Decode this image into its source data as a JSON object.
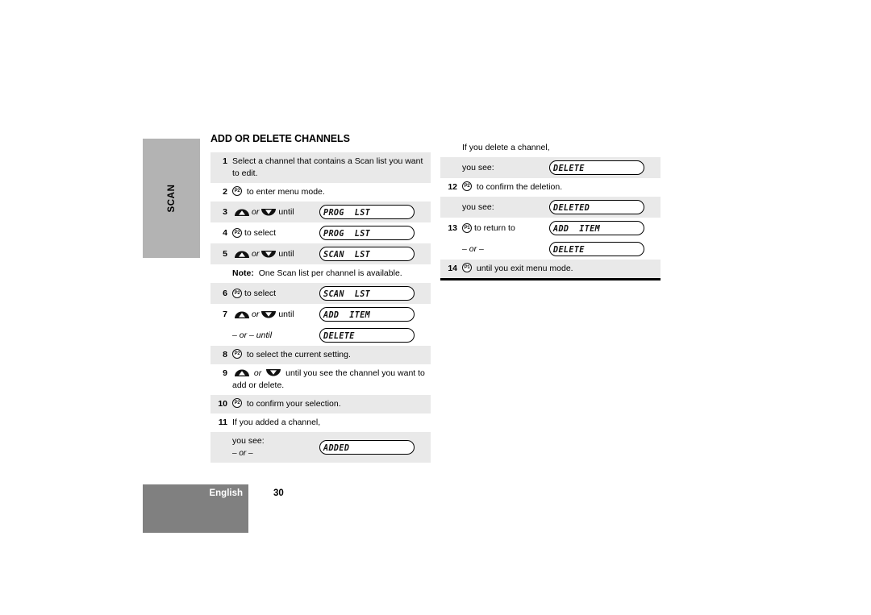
{
  "chapter_tab": {
    "label": "SCAN"
  },
  "footer": {
    "language": "English",
    "page_number": "30"
  },
  "left_column": {
    "title": "ADD OR DELETE CHANNELS",
    "steps": [
      {
        "num": "1",
        "shade": "gray",
        "text": "Select a channel that contains a Scan list you want to edit."
      },
      {
        "num": "2",
        "shade": "white",
        "icon": "p2-button-icon",
        "icon_label": "P2",
        "text": "to enter menu mode."
      },
      {
        "num": "3",
        "shade": "gray",
        "icon": "up-down-button-icon",
        "lead_pre": "",
        "or_text": "or",
        "lead_post": "until",
        "lcd": "PROG  LST"
      },
      {
        "num": "4",
        "shade": "white",
        "icon": "p2-button-icon",
        "icon_label": "P2",
        "lead_post": "to select",
        "lcd": "PROG  LST"
      },
      {
        "num": "5",
        "shade": "gray",
        "icon": "up-down-button-icon",
        "or_text": "or",
        "lead_post": "until",
        "lcd": "SCAN  LST"
      },
      {
        "num": "",
        "shade": "white",
        "note_label": "Note:",
        "note_text": "One Scan list per channel is available."
      },
      {
        "num": "6",
        "shade": "gray",
        "icon": "p2-button-icon",
        "icon_label": "P2",
        "lead_post": "to select",
        "lcd": "SCAN  LST"
      },
      {
        "num": "7",
        "shade": "white",
        "icon": "up-down-button-icon",
        "or_text": "or",
        "lead_post": "until",
        "lcd": "ADD  ITEM"
      },
      {
        "num": "",
        "shade": "white",
        "or_dash": "– or – until",
        "lcd": "DELETE"
      },
      {
        "num": "8",
        "shade": "gray",
        "icon": "p2-button-icon",
        "icon_label": "P2",
        "text": "to select the current setting."
      },
      {
        "num": "9",
        "shade": "white",
        "icon": "up-down-button-icon",
        "or_text": "or",
        "text": "until you see the channel you want to add or delete."
      },
      {
        "num": "10",
        "shade": "gray",
        "icon": "p2-button-icon",
        "icon_label": "P2",
        "text": "to confirm your selection."
      },
      {
        "num": "11",
        "shade": "white",
        "text": "If you added a channel,"
      },
      {
        "num": "",
        "shade": "gray",
        "you_see": "you see:",
        "or_dash": "– or –",
        "lcd": "ADDED"
      }
    ]
  },
  "right_column": {
    "steps": [
      {
        "num": "",
        "shade": "white",
        "text": "If you delete a channel,"
      },
      {
        "num": "",
        "shade": "gray",
        "you_see": "you see:",
        "lcd": "DELETE"
      },
      {
        "num": "12",
        "shade": "white",
        "icon": "p2-button-icon",
        "icon_label": "P2",
        "text": "to confirm the deletion."
      },
      {
        "num": "",
        "shade": "gray",
        "you_see": "you see:",
        "lcd": "DELETED"
      },
      {
        "num": "13",
        "shade": "white",
        "icon": "p1-button-icon",
        "icon_label": "P1",
        "lead_post": "to return to",
        "lcd": "ADD  ITEM"
      },
      {
        "num": "",
        "shade": "white",
        "or_dash": "– or –",
        "lcd": "DELETE"
      },
      {
        "num": "14",
        "shade": "gray",
        "icon": "p1-button-icon",
        "icon_label": "P1",
        "text": "until you exit menu mode."
      }
    ]
  },
  "colors": {
    "row_shade": "#e9e9e9",
    "tab_gray": "#b3b3b3",
    "footer_gray": "#808080",
    "text": "#000000"
  }
}
